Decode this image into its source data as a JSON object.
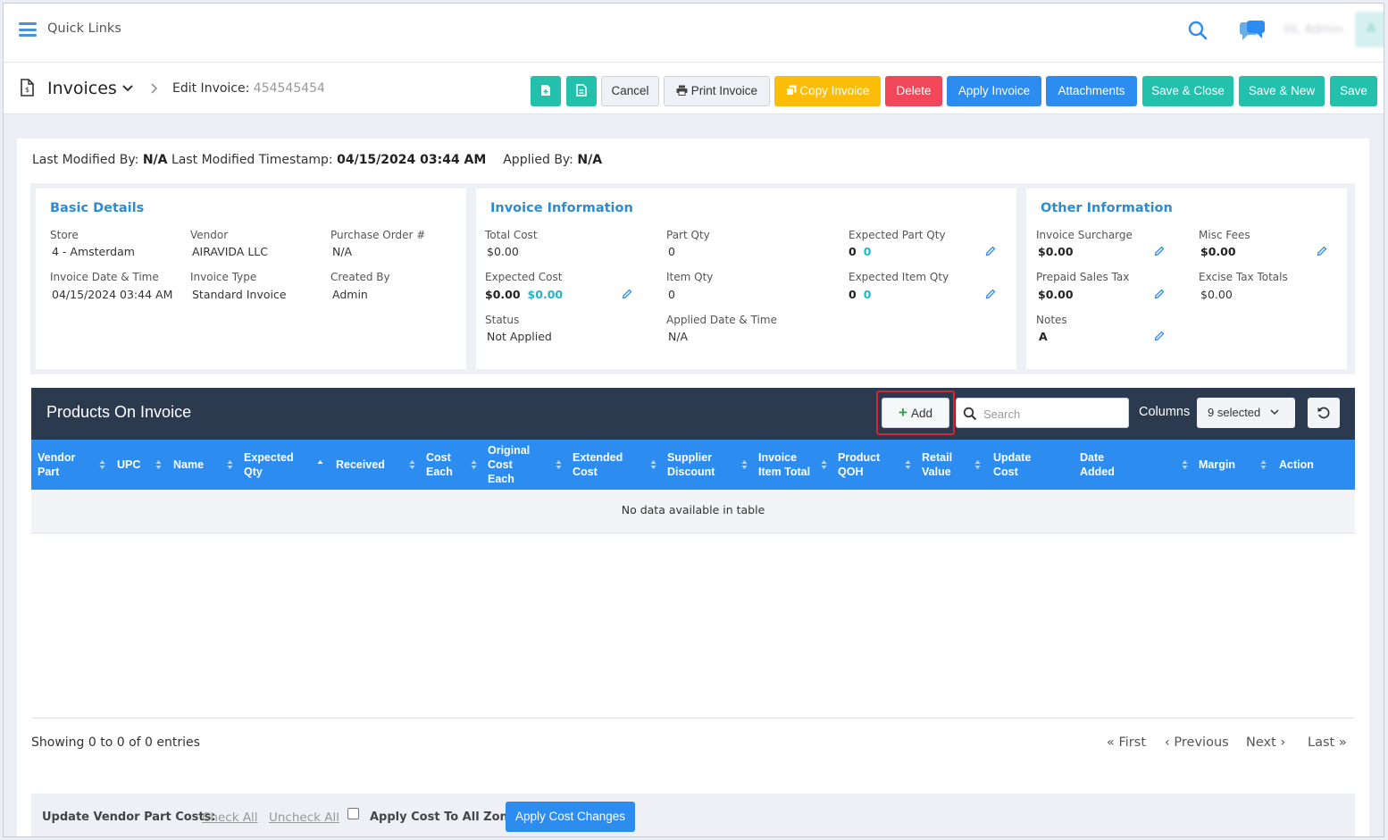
{
  "topbar": {
    "quick_links": "Quick Links",
    "user_name": "Hi, Admin",
    "avatar_letter": "A"
  },
  "header": {
    "title": "Invoices",
    "breadcrumb_label": "Edit Invoice:",
    "invoice_number": "454545454",
    "buttons": {
      "cancel": "Cancel",
      "print": "Print Invoice",
      "copy": "Copy Invoice",
      "delete": "Delete",
      "apply": "Apply Invoice",
      "attachments": "Attachments",
      "save_close": "Save & Close",
      "save_new": "Save & New",
      "save": "Save"
    }
  },
  "meta": {
    "modified_by_label": "Last Modified By:",
    "modified_by": "N/A",
    "timestamp_label": "Last Modified Timestamp:",
    "timestamp": "04/15/2024 03:44 AM",
    "applied_by_label": "Applied By:",
    "applied_by": "N/A"
  },
  "basic": {
    "title": "Basic Details",
    "store_label": "Store",
    "store": "4 - Amsterdam",
    "vendor_label": "Vendor",
    "vendor": "AIRAVIDA LLC",
    "po_label": "Purchase Order #",
    "po": "N/A",
    "date_label": "Invoice Date & Time",
    "date": "04/15/2024 03:44 AM",
    "type_label": "Invoice Type",
    "type": "Standard Invoice",
    "created_label": "Created By",
    "created": "Admin"
  },
  "invoice_info": {
    "title": "Invoice Information",
    "total_cost_label": "Total Cost",
    "total_cost": "$0.00",
    "part_qty_label": "Part Qty",
    "part_qty": "0",
    "exp_part_qty_label": "Expected Part Qty",
    "exp_part_qty": "0",
    "exp_part_qty_alt": "0",
    "exp_cost_label": "Expected Cost",
    "exp_cost": "$0.00",
    "exp_cost_alt": "$0.00",
    "item_qty_label": "Item Qty",
    "item_qty": "0",
    "exp_item_qty_label": "Expected Item Qty",
    "exp_item_qty": "0",
    "exp_item_qty_alt": "0",
    "status_label": "Status",
    "status": "Not Applied",
    "applied_date_label": "Applied Date & Time",
    "applied_date": "N/A"
  },
  "other_info": {
    "title": "Other Information",
    "surcharge_label": "Invoice Surcharge",
    "surcharge": "$0.00",
    "misc_label": "Misc Fees",
    "misc": "$0.00",
    "prepaid_label": "Prepaid Sales Tax",
    "prepaid": "$0.00",
    "excise_label": "Excise Tax Totals",
    "excise": "$0.00",
    "notes_label": "Notes",
    "notes": "A"
  },
  "products": {
    "title": "Products On Invoice",
    "add_label": "Add",
    "search_placeholder": "Search",
    "columns_label": "Columns",
    "columns_value": "9 selected",
    "headers": [
      "Vendor Part",
      "UPC",
      "Name",
      "Expected Qty",
      "Received",
      "Cost Each",
      "Original Cost Each",
      "Extended Cost",
      "Supplier Discount",
      "Invoice Item Total",
      "Product QOH",
      "Retail Value",
      "Update Cost",
      "Date Added",
      "Margin",
      "Action"
    ],
    "empty_message": "No data available in table",
    "showing": "Showing 0 to 0 of 0 entries",
    "pager": {
      "first": "First",
      "previous": "Previous",
      "next": "Next",
      "last": "Last"
    }
  },
  "footer": {
    "label": "Update Vendor Part Costs:",
    "check_all": "Check All",
    "uncheck_all": "Uncheck All",
    "apply_zone_label": "Apply Cost To All Zone",
    "apply_button": "Apply Cost Changes"
  },
  "colors": {
    "primary_blue": "#2d8cf0",
    "teal": "#23c0ac",
    "yellow": "#fbbd08",
    "red": "#f0475a",
    "dark_header": "#2b3a4e",
    "highlight": "#e0202a"
  }
}
